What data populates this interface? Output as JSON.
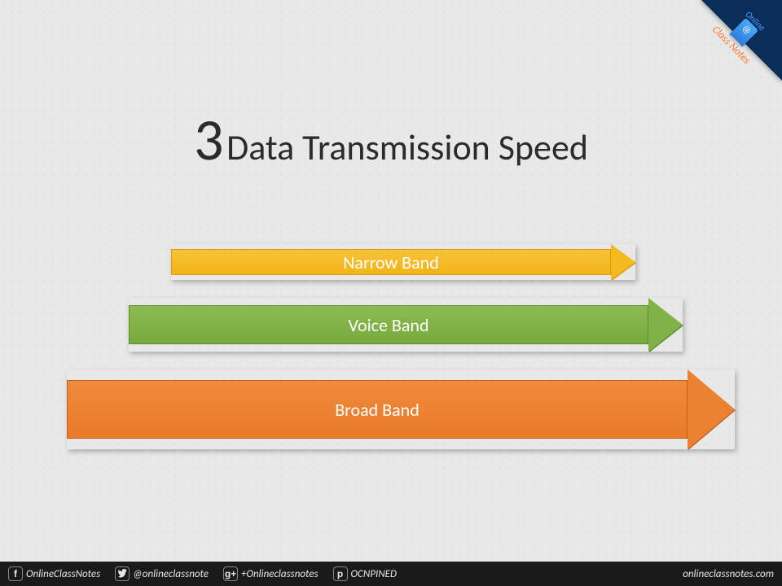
{
  "title": {
    "number": "3",
    "text": "Data Transmission Speed"
  },
  "arrows": [
    {
      "label": "Narrow Band"
    },
    {
      "label": "Voice Band"
    },
    {
      "label": "Broad Band"
    }
  ],
  "corner": {
    "line1": "Online",
    "line2": "Class Notes"
  },
  "footer": {
    "facebook_glyph": "f",
    "facebook_handle": "OnlineClassNotes",
    "twitter_handle": "@onlineclassnote",
    "gplus_glyph": "g+",
    "gplus_handle": "+Onlineclassnotes",
    "pinterest_glyph": "p",
    "pinterest_handle": "OCNPINED",
    "site": "onlineclassnotes.com"
  },
  "chart_data": {
    "type": "bar",
    "title": "3 Data Transmission Speed",
    "note": "Arrow lengths qualitatively indicate increasing bandwidth/speed; no numeric axis is shown.",
    "categories": [
      "Narrow Band",
      "Voice Band",
      "Broad Band"
    ],
    "relative_lengths": [
      570,
      680,
      820
    ],
    "colors": [
      "#f5b81f",
      "#80b247",
      "#eb8231"
    ]
  }
}
